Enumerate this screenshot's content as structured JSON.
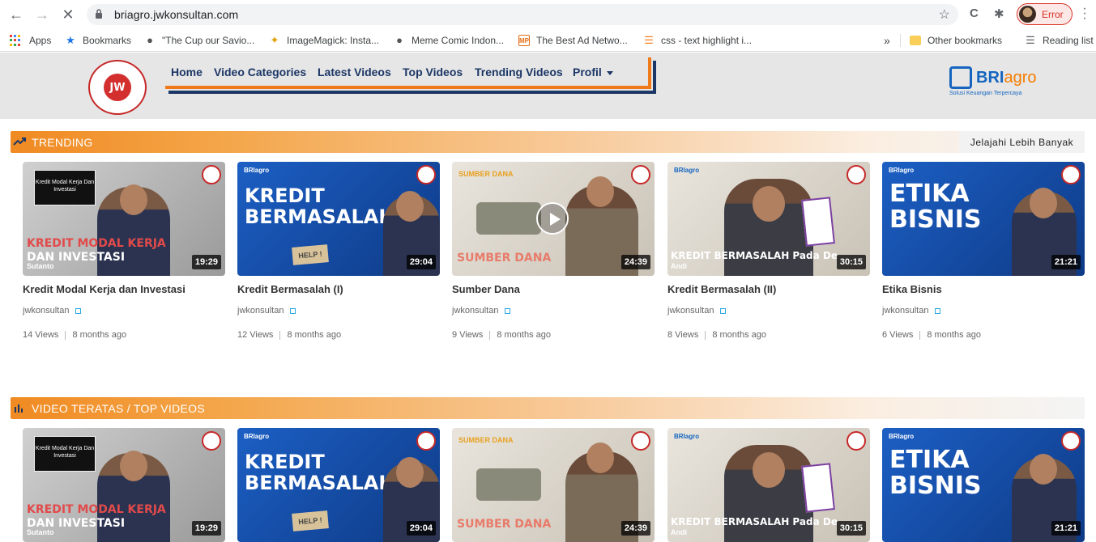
{
  "browser": {
    "url": "briagro.jwkonsultan.com",
    "profile_label": "Error",
    "bookmarks": [
      {
        "label": "Apps",
        "icon": "apps-grid-icon"
      },
      {
        "label": "Bookmarks",
        "icon": "star-icon"
      },
      {
        "label": "\"The Cup our Savio...",
        "icon": "globe-icon"
      },
      {
        "label": "ImageMagick: Insta...",
        "icon": "wand-icon"
      },
      {
        "label": "Meme Comic Indon...",
        "icon": "globe-icon"
      },
      {
        "label": "The Best Ad Netwo...",
        "icon": "mp-icon"
      },
      {
        "label": "css - text highlight i...",
        "icon": "stackoverflow-icon"
      }
    ],
    "overflow_label": "»",
    "other_bookmarks": "Other bookmarks",
    "reading_list": "Reading list"
  },
  "site": {
    "logo_text": "JW",
    "nav": [
      "Home",
      "Video Categories",
      "Latest Videos",
      "Top Videos",
      "Trending Videos",
      "Profil"
    ],
    "partner_logo": {
      "bri": "BRI",
      "agro": "agro",
      "tagline": "Solusi Keuangan Terpercaya"
    }
  },
  "sections": [
    {
      "title": "TRENDING",
      "icon": "trending-up-icon",
      "explore": "Jelajahi Lebih Banyak",
      "videos": [
        {
          "title": "Kredit Modal Kerja dan Investasi",
          "author": "jwkonsultan",
          "views": "14 Views",
          "age": "8 months ago",
          "duration": "19:29",
          "thumb": {
            "box": "Kredit Modal Kerja Dan Investasi",
            "line1": "KREDIT MODAL KERJA",
            "line2": "DAN INVESTASI",
            "name": "Sutanto"
          }
        },
        {
          "title": "Kredit Bermasalah (I)",
          "author": "jwkonsultan",
          "views": "12 Views",
          "age": "8 months ago",
          "duration": "29:04",
          "thumb": {
            "line1": "KREDIT",
            "line2": "BERMASALAH",
            "sign": "HELP !"
          }
        },
        {
          "title": "Sumber Dana",
          "author": "jwkonsultan",
          "views": "9 Views",
          "age": "8 months ago",
          "duration": "24:39",
          "thumb": {
            "line1": "SUMBER DANA",
            "line2": "SUMBER DANA"
          }
        },
        {
          "title": "Kredit Bermasalah (II)",
          "author": "jwkonsultan",
          "views": "8 Views",
          "age": "8 months ago",
          "duration": "30:15",
          "thumb": {
            "line1": "KREDIT BERMASALAH Pada De",
            "name": "Andi"
          }
        },
        {
          "title": "Etika Bisnis",
          "author": "jwkonsultan",
          "views": "6 Views",
          "age": "8 months ago",
          "duration": "21:21",
          "thumb": {
            "line1": "ETIKA",
            "line2": "BISNIS"
          }
        }
      ]
    },
    {
      "title": "VIDEO TERATAS / TOP VIDEOS",
      "icon": "bar-chart-icon",
      "videos": [
        {
          "duration": "19:29",
          "thumb": {
            "box": "Kredit Modal Kerja Dan Investasi",
            "line1": "KREDIT MODAL KERJA",
            "line2": "DAN INVESTASI",
            "name": "Sutanto"
          }
        },
        {
          "duration": "29:04",
          "thumb": {
            "line1": "KREDIT",
            "line2": "BERMASALAH",
            "sign": "HELP !"
          }
        },
        {
          "duration": "24:39",
          "thumb": {
            "line1": "SUMBER DANA",
            "line2": "SUMBER DANA"
          }
        },
        {
          "duration": "30:15",
          "thumb": {
            "line1": "KREDIT BERMASALAH Pada De",
            "name": "Andi"
          }
        },
        {
          "duration": "21:21",
          "thumb": {
            "line1": "ETIKA",
            "line2": "BISNIS"
          }
        }
      ]
    }
  ]
}
